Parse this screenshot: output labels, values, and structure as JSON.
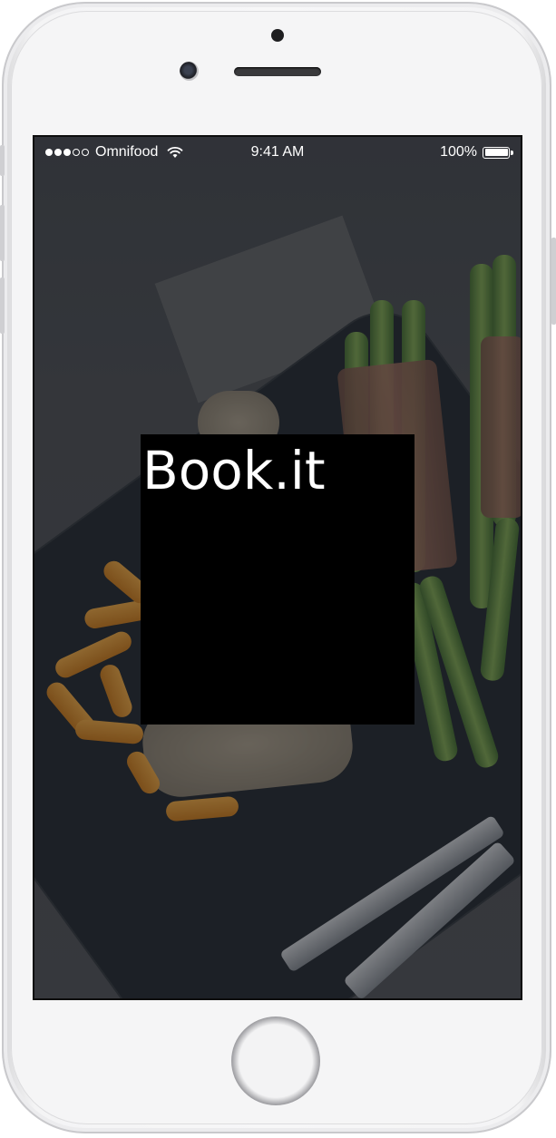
{
  "status_bar": {
    "carrier": "Omnifood",
    "time": "9:41 AM",
    "battery": "100%",
    "signal_bars_filled": 3,
    "signal_bars_total": 5
  },
  "app": {
    "logo_text": "Book.it"
  },
  "icons": {
    "wifi": "wifi-icon",
    "battery": "battery-icon",
    "signal": "signal-dots-icon"
  },
  "colors": {
    "overlay": "#1e2024",
    "logo_box": "#000000",
    "logo_text": "#ffffff"
  }
}
